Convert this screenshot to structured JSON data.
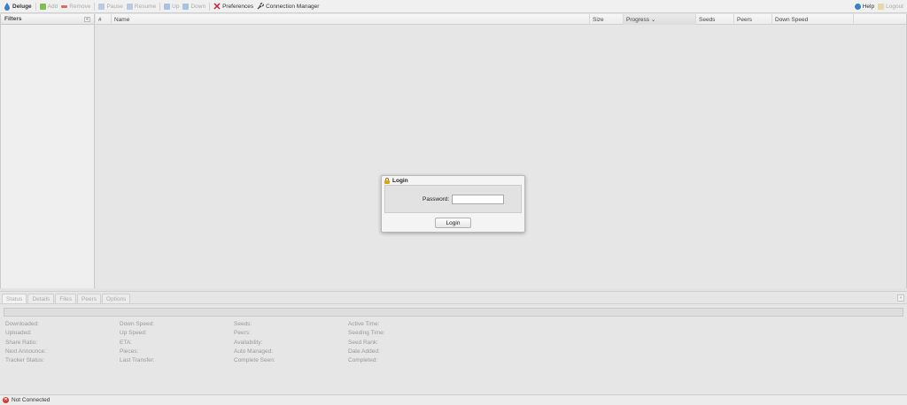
{
  "toolbar": {
    "brand": "Deluge",
    "add": "Add",
    "remove": "Remove",
    "pause": "Pause",
    "resume": "Resume",
    "up": "Up",
    "down": "Down",
    "preferences": "Preferences",
    "connection_manager": "Connection Manager",
    "help": "Help",
    "logout": "Logout"
  },
  "filters": {
    "title": "Filters"
  },
  "grid": {
    "columns": [
      "#",
      "Name",
      "Size",
      "Progress ⌄",
      "Seeds",
      "Peers",
      "Down Speed"
    ]
  },
  "login": {
    "title": "Login",
    "password_label": "Password:",
    "password_value": "",
    "button": "Login"
  },
  "details": {
    "tabs": [
      "Status",
      "Details",
      "Files",
      "Peers",
      "Options"
    ],
    "stats": [
      [
        "Downloaded:",
        "Uploaded:",
        "Share Ratio:",
        "Next Announce:",
        "Tracker Status:"
      ],
      [
        "Down Speed:",
        "Up Speed:",
        "ETA:",
        "Pieces:",
        "Last Transfer:"
      ],
      [
        "Seeds:",
        "Peers:",
        "Availability:",
        "Auto Managed:",
        "Complete Seen:"
      ],
      [
        "Active Time:",
        "Seeding Time:",
        "Seed Rank:",
        "Date Added:",
        "Completed:"
      ]
    ]
  },
  "statusbar": {
    "text": "Not Connected"
  },
  "colors": {
    "accent": "#3c7fc4",
    "error": "#d63a2e",
    "lock": "#d9a21b"
  }
}
